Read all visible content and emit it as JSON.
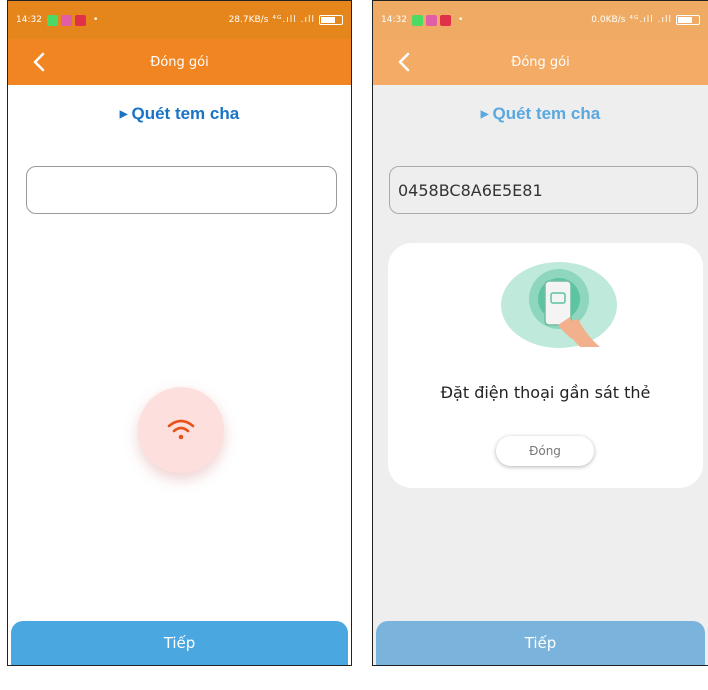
{
  "left": {
    "status": {
      "time": "14:32",
      "dot": "•",
      "network_speed": "28.7KB/s",
      "signal": "⁴ᴳ.ıll .ıll"
    },
    "appbar": {
      "title": "Đóng gói"
    },
    "section_title": "Quét tem cha",
    "scan_field": {
      "value": "",
      "placeholder": ""
    },
    "nfc_button": {
      "icon": "wifi-icon"
    },
    "footer_button": "Tiếp"
  },
  "right": {
    "status": {
      "time": "14:32",
      "dot": "•",
      "network_speed": "0.0KB/s",
      "signal": "⁴ᴳ.ıll .ıll"
    },
    "appbar": {
      "title": "Đóng gói"
    },
    "section_title": "Quét tem cha",
    "scan_field": {
      "value": "0458BC8A6E5E81"
    },
    "nfc_sheet": {
      "message": "Đặt điện thoại gần sát thẻ",
      "close_label": "Đóng"
    },
    "footer_button": "Tiếp"
  },
  "colors": {
    "appbar_orange": "#f08522",
    "appbar_orange_dimmed": "#f4ab66",
    "section_blue": "#1a73c7",
    "footer_blue": "#4aa7df",
    "nfc_icon": "#e8511a"
  }
}
